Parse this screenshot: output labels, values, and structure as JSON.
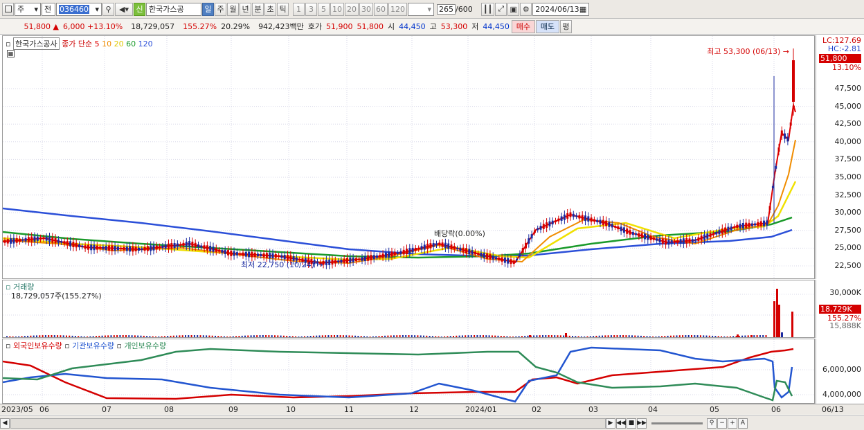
{
  "toolbar": {
    "market": "주",
    "view": "전",
    "code": "036460",
    "name_badge": "신",
    "name": "한국가스공",
    "period_tabs": [
      "일",
      "주",
      "월",
      "년",
      "분",
      "초",
      "틱"
    ],
    "active_period": "일",
    "counts": [
      "1",
      "3",
      "5",
      "10",
      "20",
      "30",
      "60",
      "120"
    ],
    "bar_count": "265",
    "bar_max": "/600",
    "date": "2024/06/13"
  },
  "quote": {
    "price": "51,800",
    "change": "6,000",
    "pct": "+13.10%",
    "volume": "18,729,057",
    "vol_ratio": "155.27%",
    "turnover": "20.29%",
    "amount": "942,423백만",
    "ask_label": "호가",
    "ask": "51,900",
    "bid": "51,800",
    "open_label": "시",
    "open": "44,450",
    "high_label": "고",
    "high": "53,300",
    "low_label": "저",
    "low": "44,450",
    "buy": "매수",
    "sell": "매도",
    "eval": "평"
  },
  "price_pane": {
    "title": "한국가스공사",
    "ma_label": "종가 단순",
    "ma_periods": [
      "5",
      "10",
      "20",
      "60",
      "120"
    ],
    "lc": "LC:127.69",
    "hc": "HC:-2.81",
    "cur_price": "51,800",
    "cur_pct": "13.10%",
    "axis_ticks": [
      "47,500",
      "45,000",
      "42,500",
      "40,000",
      "37,500",
      "35,000",
      "32,500",
      "30,000",
      "27,500",
      "25,000",
      "22,500"
    ],
    "high_note": "최고 53,300 (06/13)",
    "low_note": "최저 22,750 (10/24)",
    "div_note": "배당락(0.00%)"
  },
  "volume_pane": {
    "title": "거래량",
    "value": "18,729,057주(155.27%)",
    "axis_ticks": [
      "30,000K",
      "15,888K"
    ],
    "cur": "18,729K",
    "cur_pct": "155.27%"
  },
  "holdings_pane": {
    "legend": [
      "외국인보유수량",
      "기관보유수량",
      "개인보유수량"
    ],
    "axis_ticks": [
      "6,000,000",
      "4,000,000"
    ]
  },
  "xaxis": [
    "2023/05",
    "06",
    "07",
    "08",
    "09",
    "10",
    "11",
    "12",
    "2024/01",
    "02",
    "03",
    "04",
    "05",
    "06",
    "06/13"
  ],
  "colors": {
    "ma5": "#e00000",
    "ma10": "#f08c00",
    "ma20": "#f0e000",
    "ma60": "#1a9a2a",
    "ma120": "#2b4fd8",
    "foreign": "#d40000",
    "inst": "#2255d0",
    "indiv": "#2e8b57"
  }
}
